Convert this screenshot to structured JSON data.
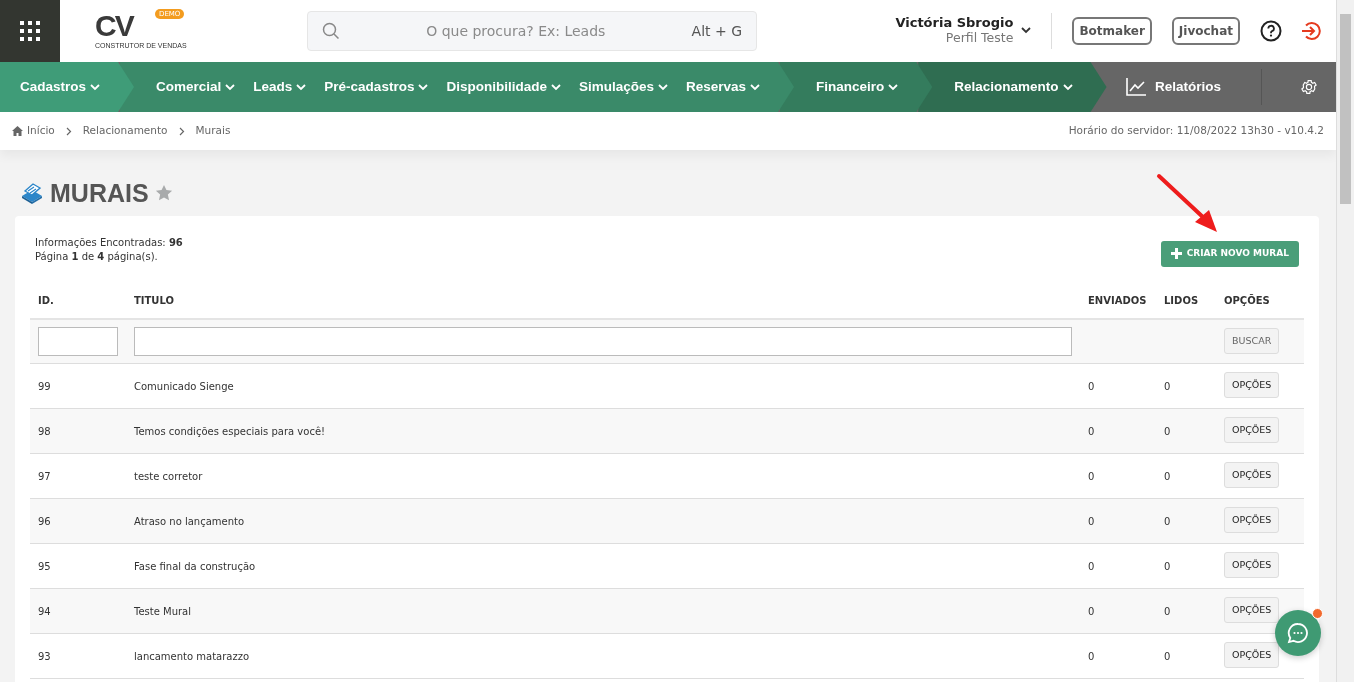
{
  "header": {
    "logo": {
      "letters": "CV",
      "badge": "DEMO",
      "tagline": "CONSTRUTOR DE VENDAS"
    },
    "search": {
      "placeholder": "O que procura? Ex: Leads",
      "shortcut": "Alt + G"
    },
    "user": {
      "name": "Victória Sbrogio",
      "profile": "Perfil Teste"
    },
    "buttons": [
      "Botmaker",
      "Jivochat"
    ]
  },
  "nav": {
    "segments": [
      {
        "color": "#3f9c78",
        "items": [
          "Cadastros"
        ]
      },
      {
        "color": "#3a8a69",
        "items": [
          "Comercial",
          "Leads",
          "Pré-cadastros",
          "Disponibilidade",
          "Simulações",
          "Reservas"
        ]
      },
      {
        "color": "#347c5d",
        "items": [
          "Financeiro"
        ]
      },
      {
        "color": "#2f6d51",
        "items": [
          "Relacionamento"
        ]
      }
    ],
    "reports": "Relatórios"
  },
  "breadcrumb": [
    "Início",
    "Relacionamento",
    "Murais"
  ],
  "server_info": "Horário do servidor: 11/08/2022 13h30 - v10.4.2",
  "page": {
    "title": "MURAIS",
    "favorite": false
  },
  "summary": [
    "Informações Encontradas: **96**",
    "Página **1** de **4** página(s)."
  ],
  "create_button": "CRIAR NOVO MURAL",
  "table": {
    "columns": [
      "ID.",
      "TITULO",
      "ENVIADOS",
      "LIDOS",
      "OPÇÕES"
    ],
    "search_button": "BUSCAR",
    "rows": [
      {
        "id": "99",
        "title": "Comunicado Sienge",
        "sent": "0",
        "read": "0",
        "action": "OPÇÕES"
      },
      {
        "id": "98",
        "title": "Temos condições especiais para você!",
        "sent": "0",
        "read": "0",
        "action": "OPÇÕES"
      },
      {
        "id": "97",
        "title": "teste corretor",
        "sent": "0",
        "read": "0",
        "action": "OPÇÕES"
      },
      {
        "id": "96",
        "title": "Atraso no lançamento",
        "sent": "0",
        "read": "0",
        "action": "OPÇÕES"
      },
      {
        "id": "95",
        "title": "Fase final da construção",
        "sent": "0",
        "read": "0",
        "action": "OPÇÕES"
      },
      {
        "id": "94",
        "title": "Teste Mural",
        "sent": "0",
        "read": "0",
        "action": "OPÇÕES"
      },
      {
        "id": "93",
        "title": "lancamento matarazzo",
        "sent": "0",
        "read": "0",
        "action": "OPÇÕES"
      }
    ]
  },
  "chat": {
    "unread": true
  }
}
